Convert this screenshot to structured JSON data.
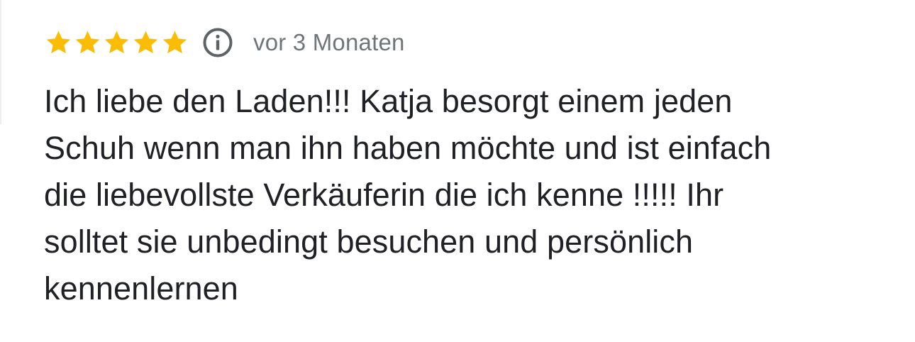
{
  "review": {
    "rating": 5,
    "rating_max": 5,
    "star_color": "#fbbc04",
    "star_icon": "star-icon",
    "info_icon": "info-icon",
    "time_ago": "vor 3 Monaten",
    "text_lines": [
      "Ich liebe den Laden!!! Katja besorgt einem jeden",
      "Schuh wenn man ihn haben möchte und ist einfach",
      "die liebevollste Verkäuferin die ich kenne !!!!! Ihr",
      "solltet sie unbedingt besuchen und persönlich",
      "kennenlernen"
    ]
  }
}
